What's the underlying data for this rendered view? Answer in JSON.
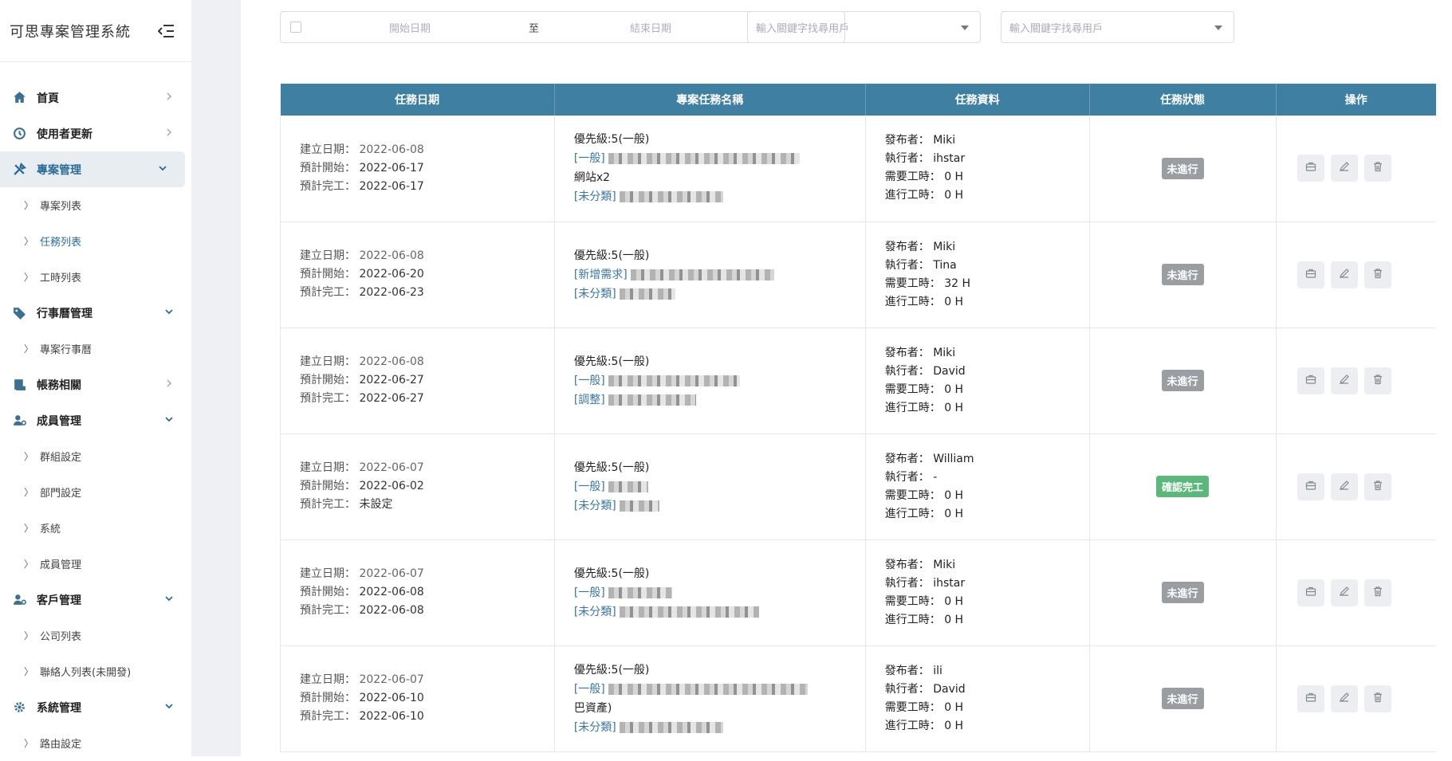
{
  "app": {
    "title": "可思專案管理系統"
  },
  "sidebar": {
    "items": [
      {
        "label": "首頁",
        "icon": "home-icon"
      },
      {
        "label": "使用者更新",
        "icon": "history-icon"
      },
      {
        "label": "專案管理",
        "icon": "tools-icon",
        "expanded": true
      },
      {
        "label": "專案列表",
        "sub": true
      },
      {
        "label": "任務列表",
        "sub": true,
        "active": true
      },
      {
        "label": "工時列表",
        "sub": true
      },
      {
        "label": "行事曆管理",
        "icon": "tag-icon",
        "expanded": true
      },
      {
        "label": "專案行事曆",
        "sub": true
      },
      {
        "label": "帳務相關",
        "icon": "ledger-icon"
      },
      {
        "label": "成員管理",
        "icon": "users-cog-icon",
        "expanded": true
      },
      {
        "label": "群組設定",
        "sub": true
      },
      {
        "label": "部門設定",
        "sub": true
      },
      {
        "label": "系統",
        "sub": true
      },
      {
        "label": "成員管理",
        "sub": true
      },
      {
        "label": "客戶管理",
        "icon": "users-cog-icon",
        "expanded": true
      },
      {
        "label": "公司列表",
        "sub": true
      },
      {
        "label": "聯絡人列表(未開發)",
        "sub": true
      },
      {
        "label": "系統管理",
        "icon": "gear-icon",
        "expanded": true
      },
      {
        "label": "路由設定",
        "sub": true
      }
    ]
  },
  "filters": {
    "date_start_placeholder": "開始日期",
    "date_to": "至",
    "date_end_placeholder": "結束日期",
    "user_select_1_placeholder": "輸入關鍵字找尋用戶",
    "user_select_2_placeholder": "輸入關鍵字找尋用戶"
  },
  "table": {
    "headers": [
      "任務日期",
      "專案任務名稱",
      "任務資料",
      "任務狀態",
      "操作"
    ],
    "labels": {
      "created": "建立日期：",
      "plan_start": "預計開始：",
      "plan_end": "預計完工：",
      "publisher": "發布者：",
      "assignee": "執行者：",
      "need_hours": "需要工時：",
      "work_hours": "進行工時："
    },
    "rows": [
      {
        "created": "2022-06-08",
        "start": "2022-06-17",
        "end": "2022-06-17",
        "priority": "優先級:5(一般)",
        "tag1": "[一般]",
        "extra": "網站x2",
        "tag2": "[未分類]",
        "publisher": "Miki",
        "assignee": "ihstar",
        "need": "0 H",
        "work": "0 H",
        "status": "未進行",
        "done": false
      },
      {
        "created": "2022-06-08",
        "start": "2022-06-20",
        "end": "2022-06-23",
        "priority": "優先級:5(一般)",
        "tag1": "[新增需求]",
        "extra": "",
        "tag2": "[未分類]",
        "publisher": "Miki",
        "assignee": "Tina",
        "need": "32 H",
        "work": "0 H",
        "status": "未進行",
        "done": false
      },
      {
        "created": "2022-06-08",
        "start": "2022-06-27",
        "end": "2022-06-27",
        "priority": "優先級:5(一般)",
        "tag1": "[一般]",
        "extra": "",
        "tag2": "[調整]",
        "publisher": "Miki",
        "assignee": "David",
        "need": "0 H",
        "work": "0 H",
        "status": "未進行",
        "done": false
      },
      {
        "created": "2022-06-07",
        "start": "2022-06-02",
        "end": "未設定",
        "priority": "優先級:5(一般)",
        "tag1": "[一般]",
        "extra": "",
        "tag2": "[未分類]",
        "publisher": "William",
        "assignee": "-",
        "need": "0 H",
        "work": "0 H",
        "status": "確認完工",
        "done": true
      },
      {
        "created": "2022-06-07",
        "start": "2022-06-08",
        "end": "2022-06-08",
        "priority": "優先級:5(一般)",
        "tag1": "[一般]",
        "extra": "",
        "tag2": "[未分類]",
        "publisher": "Miki",
        "assignee": "ihstar",
        "need": "0 H",
        "work": "0 H",
        "status": "未進行",
        "done": false
      },
      {
        "created": "2022-06-07",
        "start": "2022-06-10",
        "end": "2022-06-10",
        "priority": "優先級:5(一般)",
        "tag1": "[一般]",
        "extra": "巴資產)",
        "tag2": "[未分類]",
        "publisher": "ili",
        "assignee": "David",
        "need": "0 H",
        "work": "0 H",
        "status": "未進行",
        "done": false
      }
    ]
  },
  "colors": {
    "header_bg": "#3f7fa2",
    "accent": "#2d6b9a",
    "badge_gray": "#9a9ea3",
    "badge_green": "#5cb87a"
  }
}
